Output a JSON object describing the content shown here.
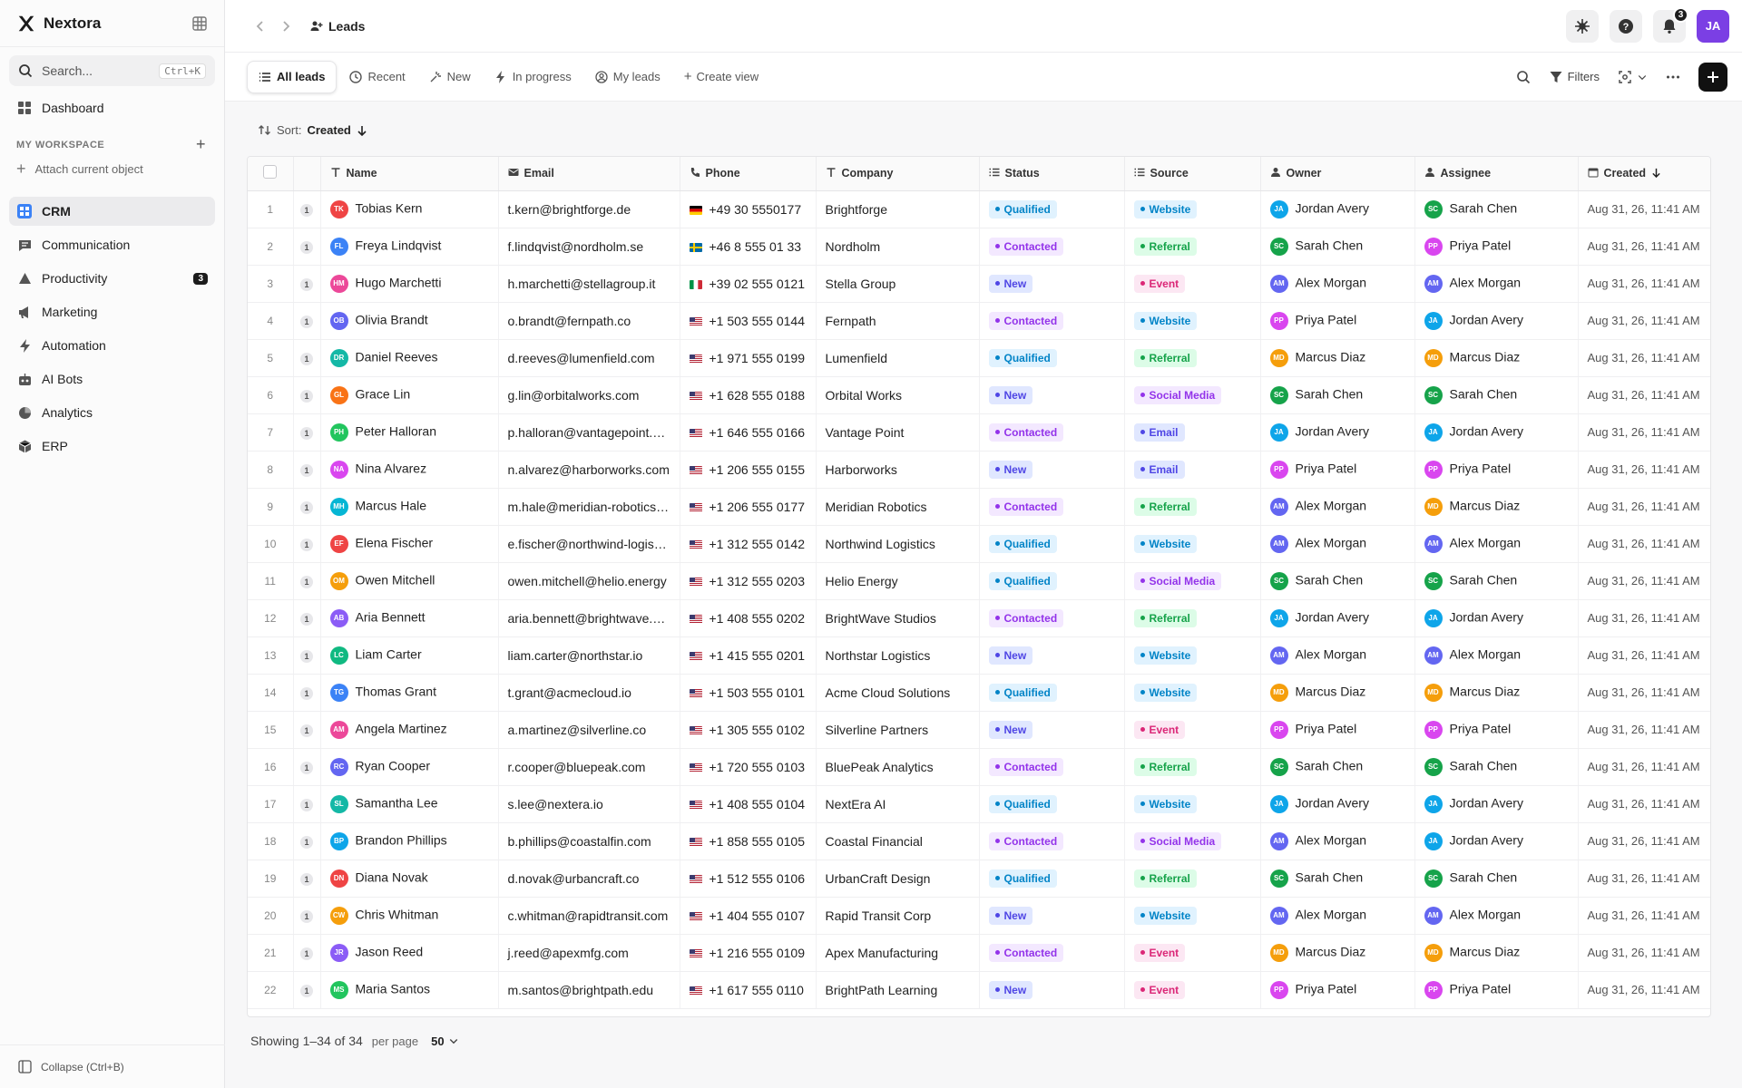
{
  "app": {
    "name": "Nextora"
  },
  "sidebar": {
    "search_placeholder": "Search...",
    "search_shortcut": "Ctrl+K",
    "dashboard": "Dashboard",
    "workspace_heading": "MY WORKSPACE",
    "attach": "Attach current object",
    "items": [
      {
        "label": "CRM",
        "icon": "crm-icon",
        "active": true
      },
      {
        "label": "Communication",
        "icon": "chat-icon"
      },
      {
        "label": "Productivity",
        "icon": "productivity-icon",
        "badge": "3"
      },
      {
        "label": "Marketing",
        "icon": "megaphone-icon"
      },
      {
        "label": "Automation",
        "icon": "bolt-icon"
      },
      {
        "label": "AI Bots",
        "icon": "bot-icon"
      },
      {
        "label": "Analytics",
        "icon": "pie-icon"
      },
      {
        "label": "ERP",
        "icon": "box-icon"
      }
    ],
    "collapse": "Collapse (Ctrl+B)"
  },
  "topbar": {
    "breadcrumb": "Leads",
    "notifications_count": "3",
    "user_initials": "JA"
  },
  "views": {
    "tabs": [
      "All leads",
      "Recent",
      "New",
      "In progress",
      "My leads"
    ],
    "create": "Create view",
    "filters": "Filters"
  },
  "sort": {
    "label": "Sort:",
    "field": "Created"
  },
  "table": {
    "columns": [
      "Name",
      "Email",
      "Phone",
      "Company",
      "Status",
      "Source",
      "Owner",
      "Assignee",
      "Created"
    ],
    "rows": [
      [
        "Tobias Kern",
        "t.kern@brightforge.de",
        "de",
        "+49 30 5550177",
        "Brightforge",
        "Qualified",
        "Website",
        "Jordan Avery",
        "Sarah Chen"
      ],
      [
        "Freya Lindqvist",
        "f.lindqvist@nordholm.se",
        "se",
        "+46 8 555 01 33",
        "Nordholm",
        "Contacted",
        "Referral",
        "Sarah Chen",
        "Priya Patel"
      ],
      [
        "Hugo Marchetti",
        "h.marchetti@stellagroup.it",
        "it",
        "+39 02 555 0121",
        "Stella Group",
        "New",
        "Event",
        "Alex Morgan",
        "Alex Morgan"
      ],
      [
        "Olivia Brandt",
        "o.brandt@fernpath.co",
        "us",
        "+1 503 555 0144",
        "Fernpath",
        "Contacted",
        "Website",
        "Priya Patel",
        "Jordan Avery"
      ],
      [
        "Daniel Reeves",
        "d.reeves@lumenfield.com",
        "us",
        "+1 971 555 0199",
        "Lumenfield",
        "Qualified",
        "Referral",
        "Marcus Diaz",
        "Marcus Diaz"
      ],
      [
        "Grace Lin",
        "g.lin@orbitalworks.com",
        "us",
        "+1 628 555 0188",
        "Orbital Works",
        "New",
        "Social Media",
        "Sarah Chen",
        "Sarah Chen"
      ],
      [
        "Peter Halloran",
        "p.halloran@vantagepoint.com",
        "us",
        "+1 646 555 0166",
        "Vantage Point",
        "Contacted",
        "Email",
        "Jordan Avery",
        "Jordan Avery"
      ],
      [
        "Nina Alvarez",
        "n.alvarez@harborworks.com",
        "us",
        "+1 206 555 0155",
        "Harborworks",
        "New",
        "Email",
        "Priya Patel",
        "Priya Patel"
      ],
      [
        "Marcus Hale",
        "m.hale@meridian-robotics.com",
        "us",
        "+1 206 555 0177",
        "Meridian Robotics",
        "Contacted",
        "Referral",
        "Alex Morgan",
        "Marcus Diaz"
      ],
      [
        "Elena Fischer",
        "e.fischer@northwind-logistics.com",
        "us",
        "+1 312 555 0142",
        "Northwind Logistics",
        "Qualified",
        "Website",
        "Alex Morgan",
        "Alex Morgan"
      ],
      [
        "Owen Mitchell",
        "owen.mitchell@helio.energy",
        "us",
        "+1 312 555 0203",
        "Helio Energy",
        "Qualified",
        "Social Media",
        "Sarah Chen",
        "Sarah Chen"
      ],
      [
        "Aria Bennett",
        "aria.bennett@brightwave.studio",
        "us",
        "+1 408 555 0202",
        "BrightWave Studios",
        "Contacted",
        "Referral",
        "Jordan Avery",
        "Jordan Avery"
      ],
      [
        "Liam Carter",
        "liam.carter@northstar.io",
        "us",
        "+1 415 555 0201",
        "Northstar Logistics",
        "New",
        "Website",
        "Alex Morgan",
        "Alex Morgan"
      ],
      [
        "Thomas Grant",
        "t.grant@acmecloud.io",
        "us",
        "+1 503 555 0101",
        "Acme Cloud Solutions",
        "Qualified",
        "Website",
        "Marcus Diaz",
        "Marcus Diaz"
      ],
      [
        "Angela Martinez",
        "a.martinez@silverline.co",
        "us",
        "+1 305 555 0102",
        "Silverline Partners",
        "New",
        "Event",
        "Priya Patel",
        "Priya Patel"
      ],
      [
        "Ryan Cooper",
        "r.cooper@bluepeak.com",
        "us",
        "+1 720 555 0103",
        "BluePeak Analytics",
        "Contacted",
        "Referral",
        "Sarah Chen",
        "Sarah Chen"
      ],
      [
        "Samantha Lee",
        "s.lee@nextera.io",
        "us",
        "+1 408 555 0104",
        "NextEra AI",
        "Qualified",
        "Website",
        "Jordan Avery",
        "Jordan Avery"
      ],
      [
        "Brandon Phillips",
        "b.phillips@coastalfin.com",
        "us",
        "+1 858 555 0105",
        "Coastal Financial",
        "Contacted",
        "Social Media",
        "Alex Morgan",
        "Jordan Avery"
      ],
      [
        "Diana Novak",
        "d.novak@urbancraft.co",
        "us",
        "+1 512 555 0106",
        "UrbanCraft Design",
        "Qualified",
        "Referral",
        "Sarah Chen",
        "Sarah Chen"
      ],
      [
        "Chris Whitman",
        "c.whitman@rapidtransit.com",
        "us",
        "+1 404 555 0107",
        "Rapid Transit Corp",
        "New",
        "Website",
        "Alex Morgan",
        "Alex Morgan"
      ],
      [
        "Jason Reed",
        "j.reed@apexmfg.com",
        "us",
        "+1 216 555 0109",
        "Apex Manufacturing",
        "Contacted",
        "Event",
        "Marcus Diaz",
        "Marcus Diaz"
      ],
      [
        "Maria Santos",
        "m.santos@brightpath.edu",
        "us",
        "+1 617 555 0110",
        "BrightPath Learning",
        "New",
        "Event",
        "Priya Patel",
        "Priya Patel"
      ]
    ],
    "created_value": "Aug 31, 26, 11:41 AM",
    "row_count_badge": "1"
  },
  "footer": {
    "showing": "Showing 1–34 of 34",
    "per_page_label": "per page",
    "per_page_value": "50"
  },
  "colors": {
    "status": {
      "Qualified": [
        "#e0f2fe",
        "#0284c7"
      ],
      "Contacted": [
        "#f3e8ff",
        "#9333ea"
      ],
      "New": [
        "#e0e7ff",
        "#4f46e5"
      ]
    },
    "source": {
      "Website": [
        "#e0f2fe",
        "#0284c7"
      ],
      "Referral": [
        "#dcfce7",
        "#16a34a"
      ],
      "Event": [
        "#fce7f3",
        "#db2777"
      ],
      "Social Media": [
        "#f3e8ff",
        "#9333ea"
      ],
      "Email": [
        "#e0e7ff",
        "#4f46e5"
      ]
    },
    "people": {
      "Jordan Avery": "#0ea5e9",
      "Sarah Chen": "#16a34a",
      "Priya Patel": "#d946ef",
      "Alex Morgan": "#6366f1",
      "Marcus Diaz": "#f59e0b"
    },
    "lead_avatars": [
      "#ef4444",
      "#3b82f6",
      "#ec4899",
      "#6366f1",
      "#14b8a6",
      "#f97316",
      "#22c55e",
      "#d946ef",
      "#06b6d4",
      "#ef4444",
      "#f59e0b",
      "#8b5cf6",
      "#10b981",
      "#3b82f6",
      "#ec4899",
      "#6366f1",
      "#14b8a6",
      "#0ea5e9",
      "#ef4444",
      "#f59e0b",
      "#8b5cf6",
      "#22c55e"
    ]
  }
}
